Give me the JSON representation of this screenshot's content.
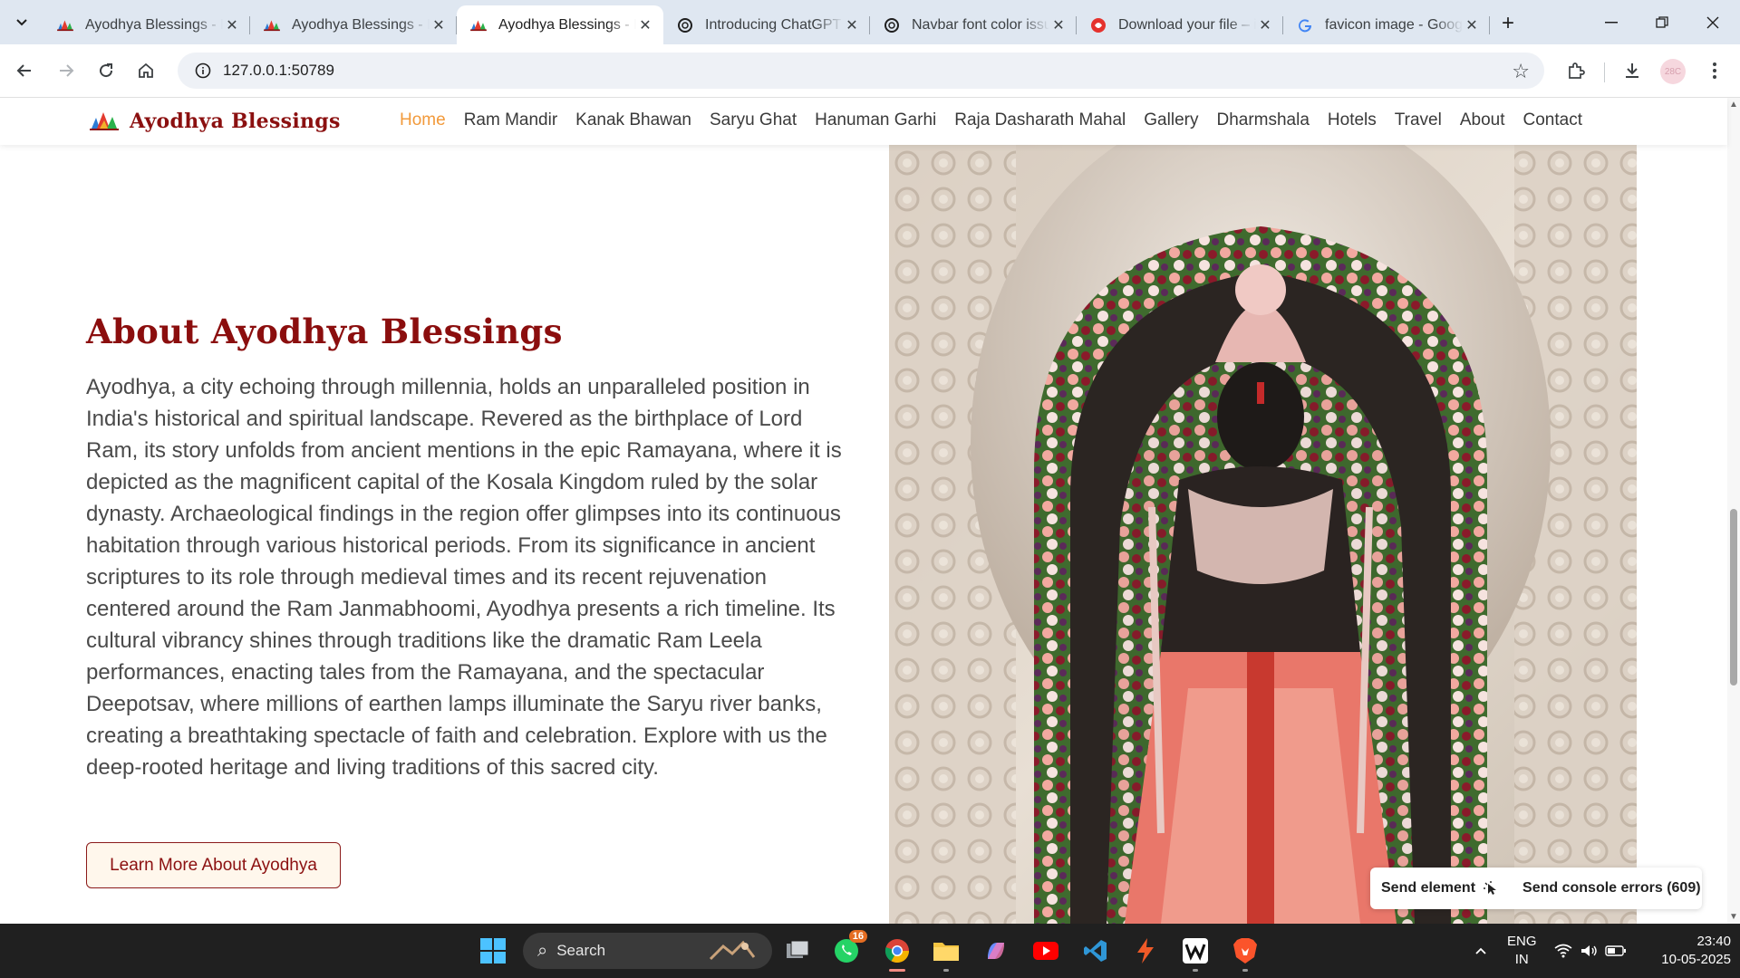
{
  "browser": {
    "tabs": [
      {
        "title": "Ayodhya Blessings - Home",
        "active": false,
        "favicon": "ayodhya-logo-icon"
      },
      {
        "title": "Ayodhya Blessings - Home",
        "active": false,
        "favicon": "ayodhya-logo-icon"
      },
      {
        "title": "Ayodhya Blessings - Home",
        "active": true,
        "favicon": "ayodhya-logo-icon"
      },
      {
        "title": "Introducing ChatGPT",
        "active": false,
        "favicon": "openai-icon"
      },
      {
        "title": "Navbar font color issue",
        "active": false,
        "favicon": "openai-icon"
      },
      {
        "title": "Download your file – iLovePDF",
        "active": false,
        "favicon": "ilovepdf-icon"
      },
      {
        "title": "favicon image - Google Search",
        "active": false,
        "favicon": "google-icon"
      }
    ],
    "url": "127.0.0.1:50789",
    "profile_initials": "28C"
  },
  "site": {
    "brand": "Ayodhya Blessings",
    "nav": [
      "Home",
      "Ram Mandir",
      "Kanak Bhawan",
      "Saryu Ghat",
      "Hanuman Garhi",
      "Raja Dasharath Mahal",
      "Gallery",
      "Dharmshala",
      "Hotels",
      "Travel",
      "About",
      "Contact"
    ],
    "active_nav": "Home",
    "about": {
      "title": "About Ayodhya Blessings",
      "body": "Ayodhya, a city echoing through millennia, holds an unparalleled position in India's historical and spiritual landscape. Revered as the birthplace of Lord Ram, its story unfolds from ancient mentions in the epic Ramayana, where it is depicted as the magnificent capital of the Kosala Kingdom ruled by the solar dynasty. Archaeological findings in the region offer glimpses into its continuous habitation through various historical periods. From its significance in ancient scriptures to its role through medieval times and its recent rejuvenation centered around the Ram Janmabhoomi, Ayodhya presents a rich timeline. Its cultural vibrancy shines through traditions like the dramatic Ram Leela performances, enacting tales from the Ramayana, and the spectacular Deepotsav, where millions of earthen lamps illuminate the Saryu river banks, creating a breathtaking spectacle of faith and celebration. Explore with us the deep-rooted heritage and living traditions of this sacred city.",
      "button": "Learn More About Ayodhya"
    },
    "colors": {
      "brand": "#8b1010",
      "nav_active": "#f29a3b",
      "button_bg": "#fff7ec"
    }
  },
  "overlay": {
    "send_element": "Send element",
    "send_console": "Send console errors (609)"
  },
  "taskbar": {
    "search_placeholder": "Search",
    "whatsapp_badge": "16",
    "lang_line1": "ENG",
    "lang_line2": "IN",
    "time": "23:40",
    "date": "10-05-2025"
  }
}
